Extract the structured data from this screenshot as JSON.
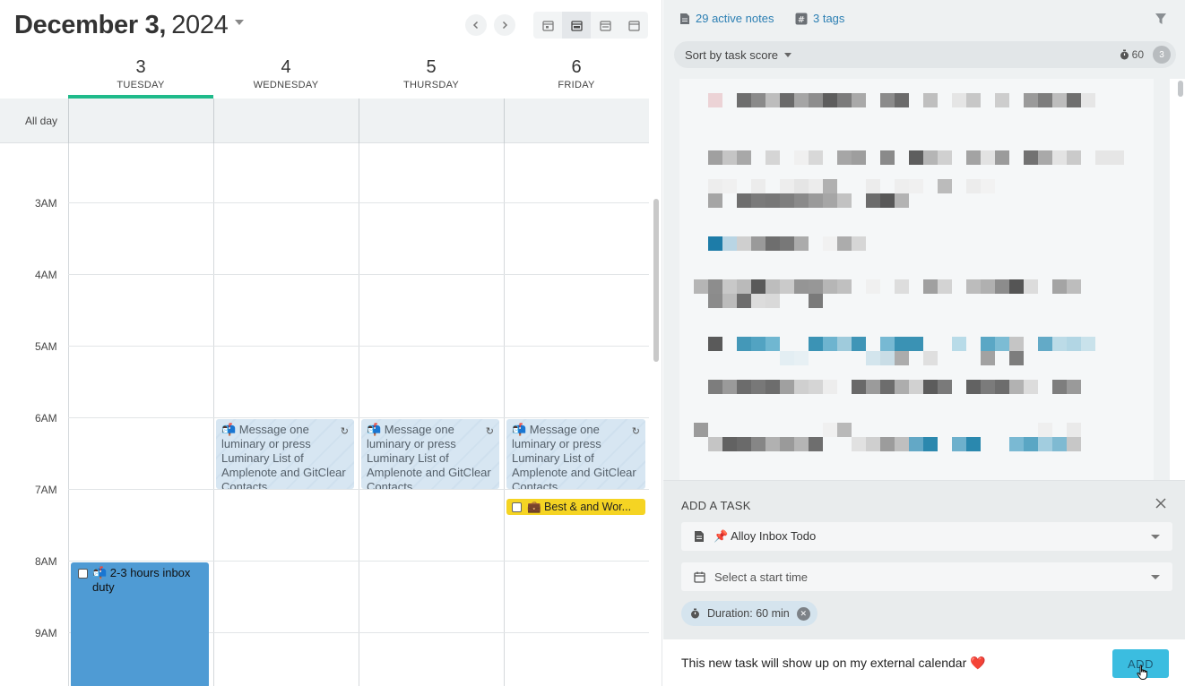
{
  "calendar": {
    "title_month_day": "December 3,",
    "title_year": "2024",
    "nav": {
      "prev": "‹",
      "next": "›"
    },
    "days": [
      {
        "num": "3",
        "dow": "TUESDAY",
        "today": true
      },
      {
        "num": "4",
        "dow": "WEDNESDAY",
        "today": false
      },
      {
        "num": "5",
        "dow": "THURSDAY",
        "today": false
      },
      {
        "num": "6",
        "dow": "FRIDAY",
        "today": false
      }
    ],
    "all_day_label": "All day",
    "hours": [
      "3AM",
      "4AM",
      "5AM",
      "6AM",
      "7AM",
      "8AM",
      "9AM"
    ],
    "events": {
      "recurring_text": "📬 Message one luminary or press Luminary List of Amplenote and GitClear Contacts.",
      "recur_icon": "↻",
      "inbox_duty": "📬 2-3 hours inbox duty",
      "best_and_worst": "💼 Best & and Wor..."
    }
  },
  "panel": {
    "active_notes": "29 active notes",
    "tags": "3 tags",
    "sort_label": "Sort by task score",
    "timer_value": "60",
    "badge_count": "3",
    "add_task": {
      "title": "ADD A TASK",
      "note": "📌 Alloy Inbox Todo",
      "start_time_placeholder": "Select a start time",
      "duration": "Duration: 60 min",
      "task_text": "This new task will show up on my external calendar ❤️",
      "add_button": "ADD"
    },
    "colors": {
      "accent": "#1fba8a",
      "link": "#2c7fb3",
      "add_button": "#3bbde0",
      "event_blue": "#4f9bd4",
      "event_yellow": "#f5d423"
    }
  }
}
